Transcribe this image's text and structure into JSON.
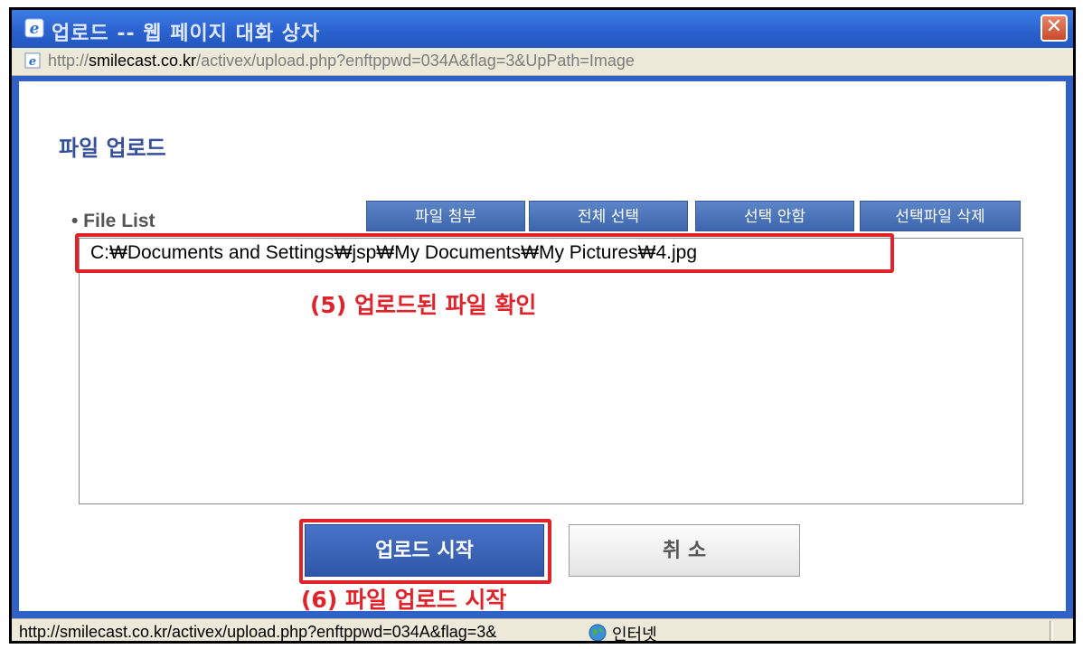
{
  "window": {
    "title": "업로드 -- 웹 페이지 대화 상자",
    "close_label": "✕"
  },
  "address": {
    "prefix": "http://",
    "host": "smilecast.co.kr",
    "path": "/activex/upload.php?enftppwd=034A&flag=3&UpPath=Image"
  },
  "page": {
    "heading": "파일 업로드",
    "file_list_label": "• File List",
    "buttons": {
      "attach": "파일 첨부",
      "select_all": "전체 선택",
      "deselect": "선택 안함",
      "delete_selected": "선택파일 삭제"
    },
    "files": [
      "C:₩Documents and Settings₩jsp₩My Documents₩My Pictures₩4.jpg"
    ],
    "annotation_uploaded": "(5) 업로드된 파일 확인",
    "start_button": "업로드 시작",
    "cancel_button": "취 소",
    "annotation_start": "(6) 파일 업로드 시작"
  },
  "status": {
    "url": "http://smilecast.co.kr/activex/upload.php?enftppwd=034A&flag=3&",
    "zone": "인터넷"
  },
  "colors": {
    "titlebar": "#2b62cf",
    "content_border": "#2f62c6",
    "highlight_red": "#e0222b",
    "heading_blue": "#34509b"
  }
}
